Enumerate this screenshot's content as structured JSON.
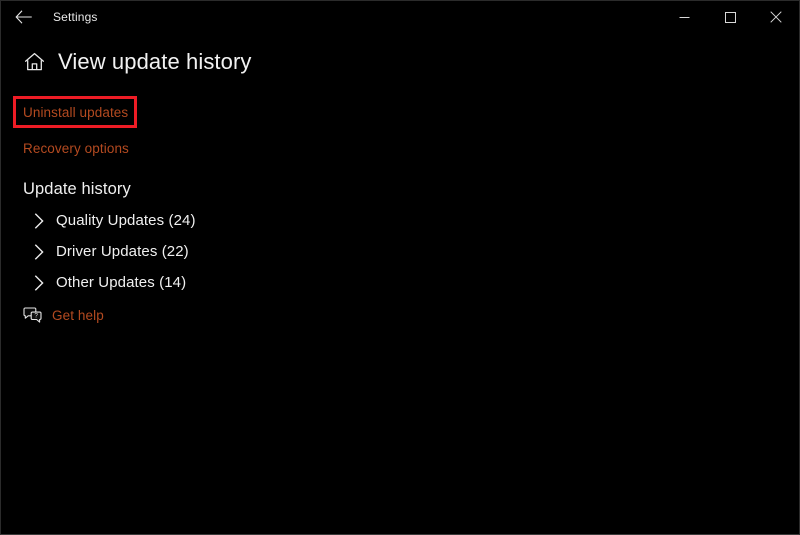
{
  "window": {
    "app_title": "Settings",
    "back_icon": "back-arrow-icon",
    "controls": {
      "minimize": "minimize-icon",
      "maximize": "maximize-icon",
      "close": "close-icon"
    }
  },
  "header": {
    "home_icon": "home-icon",
    "title": "View update history"
  },
  "links": [
    {
      "label": "Uninstall updates",
      "highlighted": true
    },
    {
      "label": "Recovery options",
      "highlighted": false
    }
  ],
  "update_history": {
    "section_title": "Update history",
    "categories": [
      {
        "label": "Quality Updates (24)",
        "name": "quality-updates",
        "count": 24,
        "expanded": false
      },
      {
        "label": "Driver Updates (22)",
        "name": "driver-updates",
        "count": 22,
        "expanded": false
      },
      {
        "label": "Other Updates (14)",
        "name": "other-updates",
        "count": 14,
        "expanded": false
      }
    ]
  },
  "get_help": {
    "icon": "help-chat-icon",
    "label": "Get help"
  },
  "colors": {
    "background": "#000000",
    "text_primary": "#f0f0f0",
    "link": "#b44a20",
    "highlight_border": "#ee1c25",
    "window_border": "#2b2b2b"
  }
}
